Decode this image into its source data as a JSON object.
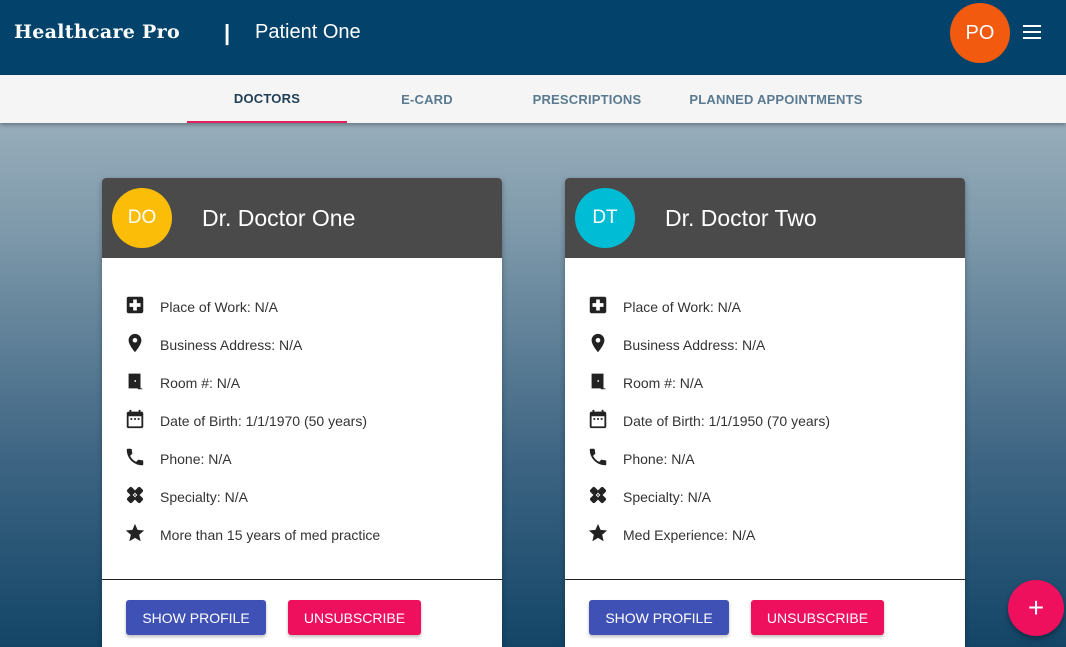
{
  "header": {
    "brand": "Healthcare Pro",
    "separator": "|",
    "patient_name": "Patient One",
    "user_initials": "PO",
    "user_avatar_color": "#f15a0f",
    "menu_icon": "hamburger-menu-icon"
  },
  "tabs": [
    {
      "label": "DOCTORS",
      "active": true
    },
    {
      "label": "E-CARD",
      "active": false
    },
    {
      "label": "PRESCRIPTIONS",
      "active": false
    },
    {
      "label": "PLANNED APPOINTMENTS",
      "active": false
    }
  ],
  "cards": [
    {
      "initials": "DO",
      "avatar_color": "#fbbd08",
      "name": "Dr. Doctor One",
      "details": [
        {
          "icon": "hospital-cross-icon",
          "text": "Place of Work: N/A"
        },
        {
          "icon": "location-pin-icon",
          "text": "Business Address: N/A"
        },
        {
          "icon": "door-icon",
          "text": "Room #: N/A"
        },
        {
          "icon": "calendar-icon",
          "text": "Date of Birth: 1/1/1970 (50 years)"
        },
        {
          "icon": "phone-icon",
          "text": "Phone: N/A"
        },
        {
          "icon": "bandage-icon",
          "text": "Specialty: N/A"
        },
        {
          "icon": "star-icon",
          "text": "More than 15 years of med practice"
        }
      ],
      "show_profile_label": "SHOW PROFILE",
      "unsubscribe_label": "UNSUBSCRIBE"
    },
    {
      "initials": "DT",
      "avatar_color": "#00bcd4",
      "name": "Dr. Doctor Two",
      "details": [
        {
          "icon": "hospital-cross-icon",
          "text": "Place of Work: N/A"
        },
        {
          "icon": "location-pin-icon",
          "text": "Business Address: N/A"
        },
        {
          "icon": "door-icon",
          "text": "Room #: N/A"
        },
        {
          "icon": "calendar-icon",
          "text": "Date of Birth: 1/1/1950 (70 years)"
        },
        {
          "icon": "phone-icon",
          "text": "Phone: N/A"
        },
        {
          "icon": "bandage-icon",
          "text": "Specialty: N/A"
        },
        {
          "icon": "star-icon",
          "text": "Med Experience: N/A"
        }
      ],
      "show_profile_label": "SHOW PROFILE",
      "unsubscribe_label": "UNSUBSCRIBE"
    }
  ],
  "fab": {
    "label": "+",
    "icon": "add-icon"
  },
  "colors": {
    "header_bg": "#03436b",
    "tab_indicator": "#e0205d",
    "primary_button": "#3f51b5",
    "danger_button": "#ee0f5d",
    "card_header": "#4a4a4a"
  }
}
